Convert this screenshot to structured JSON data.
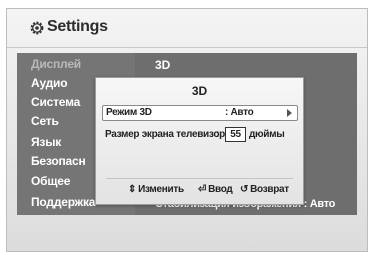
{
  "header": {
    "title": "Settings",
    "icon": "gear-icon"
  },
  "sidebar": {
    "items": [
      {
        "label": "Дисплей",
        "active": true
      },
      {
        "label": "Аудио"
      },
      {
        "label": "Система"
      },
      {
        "label": "Сеть"
      },
      {
        "label": "Язык"
      },
      {
        "label": "Безопасн"
      },
      {
        "label": "Общее"
      },
      {
        "label": "Поддержка"
      }
    ]
  },
  "content": {
    "title": "3D",
    "bottom_item": "Стабилизация изображения : Авто"
  },
  "dialog": {
    "title": "3D",
    "rows": [
      {
        "label": "Режим 3D",
        "value": ": Авто"
      },
      {
        "label": "Размер экрана телевизора",
        "sep": ":",
        "value": "55",
        "unit": "дюймы"
      }
    ],
    "footer": {
      "change": "Изменить",
      "enter": "Ввод",
      "back": "Возврат"
    }
  }
}
